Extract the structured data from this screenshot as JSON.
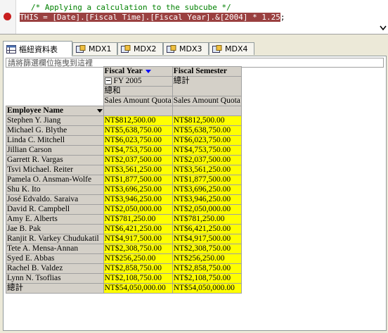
{
  "code": {
    "comment": "/* Applying a calculation to the subcube */",
    "statement": "THIS = [Date].[Fiscal Time].[Fiscal Year].&[2004] * 1.25",
    "terminator": ";"
  },
  "tabs": [
    {
      "label": "樞紐資料表",
      "icon": "pivot-table-icon",
      "active": true
    },
    {
      "label": "MDX1",
      "icon": "mdx-query-icon",
      "active": false
    },
    {
      "label": "MDX2",
      "icon": "mdx-query-icon",
      "active": false
    },
    {
      "label": "MDX3",
      "icon": "mdx-query-icon",
      "active": false
    },
    {
      "label": "MDX4",
      "icon": "mdx-query-icon",
      "active": false
    }
  ],
  "filter_bar": {
    "placeholder": "請將篩選欄位拖曳到這裡"
  },
  "pivot": {
    "col_fields": [
      "Fiscal Year",
      "Fiscal Semester"
    ],
    "fy_label": "FY 2005",
    "subtotal_label": "總和",
    "grand_total_col_label": "總計",
    "measure_label": "Sales Amount Quota",
    "row_field": "Employee Name",
    "rows": [
      {
        "name": "Stephen Y. Jiang",
        "fy2005": "NT$812,500.00",
        "total": "NT$812,500.00"
      },
      {
        "name": "Michael G. Blythe",
        "fy2005": "NT$5,638,750.00",
        "total": "NT$5,638,750.00"
      },
      {
        "name": "Linda C. Mitchell",
        "fy2005": "NT$6,023,750.00",
        "total": "NT$6,023,750.00"
      },
      {
        "name": "Jillian Carson",
        "fy2005": "NT$4,753,750.00",
        "total": "NT$4,753,750.00"
      },
      {
        "name": "Garrett R. Vargas",
        "fy2005": "NT$2,037,500.00",
        "total": "NT$2,037,500.00"
      },
      {
        "name": "Tsvi Michael. Reiter",
        "fy2005": "NT$3,561,250.00",
        "total": "NT$3,561,250.00"
      },
      {
        "name": "Pamela O. Ansman-Wolfe",
        "fy2005": "NT$1,877,500.00",
        "total": "NT$1,877,500.00"
      },
      {
        "name": "Shu K. Ito",
        "fy2005": "NT$3,696,250.00",
        "total": "NT$3,696,250.00"
      },
      {
        "name": "José Edvaldo. Saraiva",
        "fy2005": "NT$3,946,250.00",
        "total": "NT$3,946,250.00"
      },
      {
        "name": "David R. Campbell",
        "fy2005": "NT$2,050,000.00",
        "total": "NT$2,050,000.00"
      },
      {
        "name": "Amy E. Alberts",
        "fy2005": "NT$781,250.00",
        "total": "NT$781,250.00"
      },
      {
        "name": "Jae B. Pak",
        "fy2005": "NT$6,421,250.00",
        "total": "NT$6,421,250.00"
      },
      {
        "name": "Ranjit R. Varkey Chudukatil",
        "fy2005": "NT$4,917,500.00",
        "total": "NT$4,917,500.00"
      },
      {
        "name": "Tete A. Mensa-Annan",
        "fy2005": "NT$2,308,750.00",
        "total": "NT$2,308,750.00"
      },
      {
        "name": "Syed E. Abbas",
        "fy2005": "NT$256,250.00",
        "total": "NT$256,250.00"
      },
      {
        "name": "Rachel B. Valdez",
        "fy2005": "NT$2,858,750.00",
        "total": "NT$2,858,750.00"
      },
      {
        "name": "Lynn N. Tsoflias",
        "fy2005": "NT$2,108,750.00",
        "total": "NT$2,108,750.00"
      }
    ],
    "grand_total": {
      "name": "總計",
      "fy2005": "NT$54,050,000.00",
      "total": "NT$54,050,000.00"
    }
  }
}
